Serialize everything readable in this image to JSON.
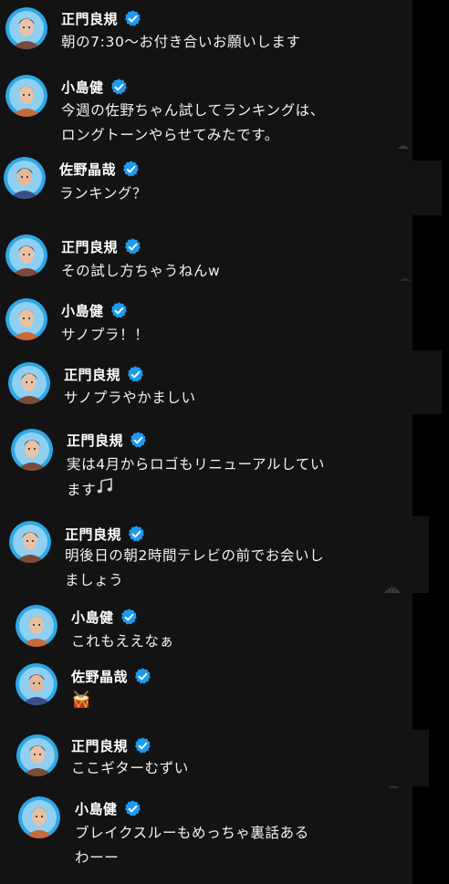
{
  "messages": [
    {
      "author": "正門良規",
      "lines": [
        "朝の7:30〜お付き合いお願いします"
      ],
      "avatar": "avatar-seimon"
    },
    {
      "author": "小島健",
      "lines": [
        "今週の佐野ちゃん試してランキングは、",
        "ロングトーンやらせてみたです。"
      ],
      "avatar": "avatar-kojima"
    },
    {
      "author": "佐野晶哉",
      "lines": [
        "ランキング？"
      ],
      "avatar": "avatar-sano"
    },
    {
      "author": "正門良規",
      "lines": [
        "その試し方ちゃうねんw"
      ],
      "avatar": "avatar-seimon"
    },
    {
      "author": "小島健",
      "lines": [
        "サノプラ！！"
      ],
      "avatar": "avatar-kojima"
    },
    {
      "author": "正門良規",
      "lines": [
        "サノプラやかましい"
      ],
      "avatar": "avatar-seimon"
    },
    {
      "author": "正門良規",
      "lines": [
        "実は4月からロゴもリニューアルしてい",
        "ます"
      ],
      "emoji": "musical-notes-icon",
      "avatar": "avatar-seimon"
    },
    {
      "author": "正門良規",
      "lines": [
        "明後日の朝2時間テレビの前でお会いし",
        "ましょう"
      ],
      "avatar": "avatar-seimon"
    },
    {
      "author": "小島健",
      "lines": [
        "これもええなぁ"
      ],
      "avatar": "avatar-kojima"
    },
    {
      "author": "佐野晶哉",
      "lines": [
        ""
      ],
      "emoji": "drum-icon",
      "avatar": "avatar-sano"
    },
    {
      "author": "正門良規",
      "lines": [
        "ここギターむずい"
      ],
      "avatar": "avatar-seimon"
    },
    {
      "author": "小島健",
      "lines": [
        "ブレイクスルーもめっちゃ裏話ある",
        "わーー"
      ],
      "avatar": "avatar-kojima"
    }
  ],
  "colors": {
    "background": "#000000",
    "panel": "#131313",
    "text": "#f2f2f2",
    "verified_badge": "#1d9bf0",
    "avatar_ring": "#2ea8e8"
  },
  "icons": {
    "verified": "verified-badge-icon",
    "reaction": "reaction-icon"
  }
}
